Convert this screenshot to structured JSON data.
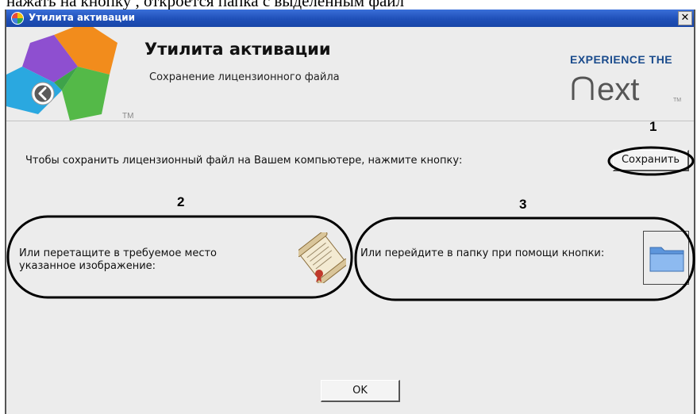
{
  "top_strip_text": "нажать на кнопку , откроется папка с выделенным файл",
  "window": {
    "title": "Утилита активации",
    "close_glyph": "✕"
  },
  "header": {
    "title": "Утилита активации",
    "subtitle": "Сохранение лицензионного файла",
    "logo_tm": "TM",
    "brand_tagline": "EXPERIENCE THE",
    "brand_word": "next",
    "brand_tm": "TM"
  },
  "save_section": {
    "text": "Чтобы сохранить лицензионный файл на Вашем компьютере, нажмите кнопку:",
    "button_label": "Сохранить"
  },
  "drag_section": {
    "text": "Или перетащите в требуемое место указанное изображение:",
    "icon": "scroll-document-icon"
  },
  "folder_section": {
    "text": "Или перейдите в папку при помощи кнопки:",
    "icon": "folder-icon"
  },
  "ok_button_label": "OK",
  "annotations": {
    "label_1": "1",
    "label_2": "2",
    "label_3": "3"
  },
  "colors": {
    "titlebar": "#1f4fb8",
    "brand": "#1a4b8c",
    "folder": "#6ea6e8"
  }
}
